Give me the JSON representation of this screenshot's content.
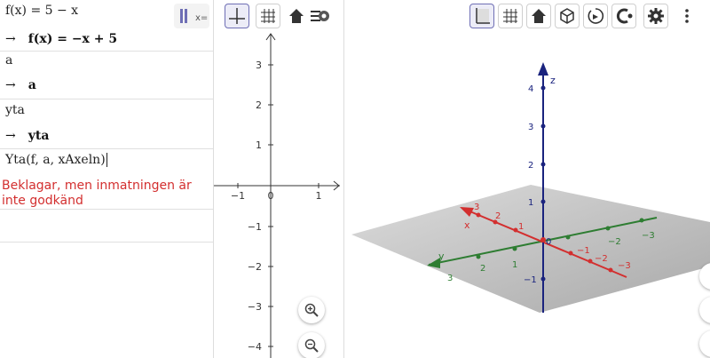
{
  "cas": {
    "rows": [
      {
        "input": "f(x) = 5 − x",
        "output": "f(x) = −x + 5"
      },
      {
        "input": "a",
        "output": "a"
      },
      {
        "input": "yta",
        "output": "yta"
      },
      {
        "input": "Yta(f, a, xAxeln)",
        "error": "Beklagar, men inmatningen är inte godkänd"
      }
    ],
    "arrow": "→",
    "toggle_label": "x="
  },
  "view2d": {
    "x_ticks": [
      "−1",
      "0",
      "1"
    ],
    "y_ticks": [
      "3",
      "2",
      "1",
      "−1",
      "−2",
      "−3",
      "−4"
    ]
  },
  "view3d": {
    "axis_labels": {
      "x": "x",
      "y": "y",
      "z": "z"
    },
    "z_ticks": [
      "4",
      "3",
      "2",
      "1",
      "0",
      "−1"
    ],
    "x_ticks": [
      "3",
      "2",
      "1",
      "−1",
      "−2",
      "−3"
    ],
    "y_ticks": [
      "3",
      "2",
      "1",
      "−2",
      "−3"
    ],
    "colors": {
      "x": "#d32f2f",
      "y": "#2e7d32",
      "z": "#1a237e"
    }
  }
}
